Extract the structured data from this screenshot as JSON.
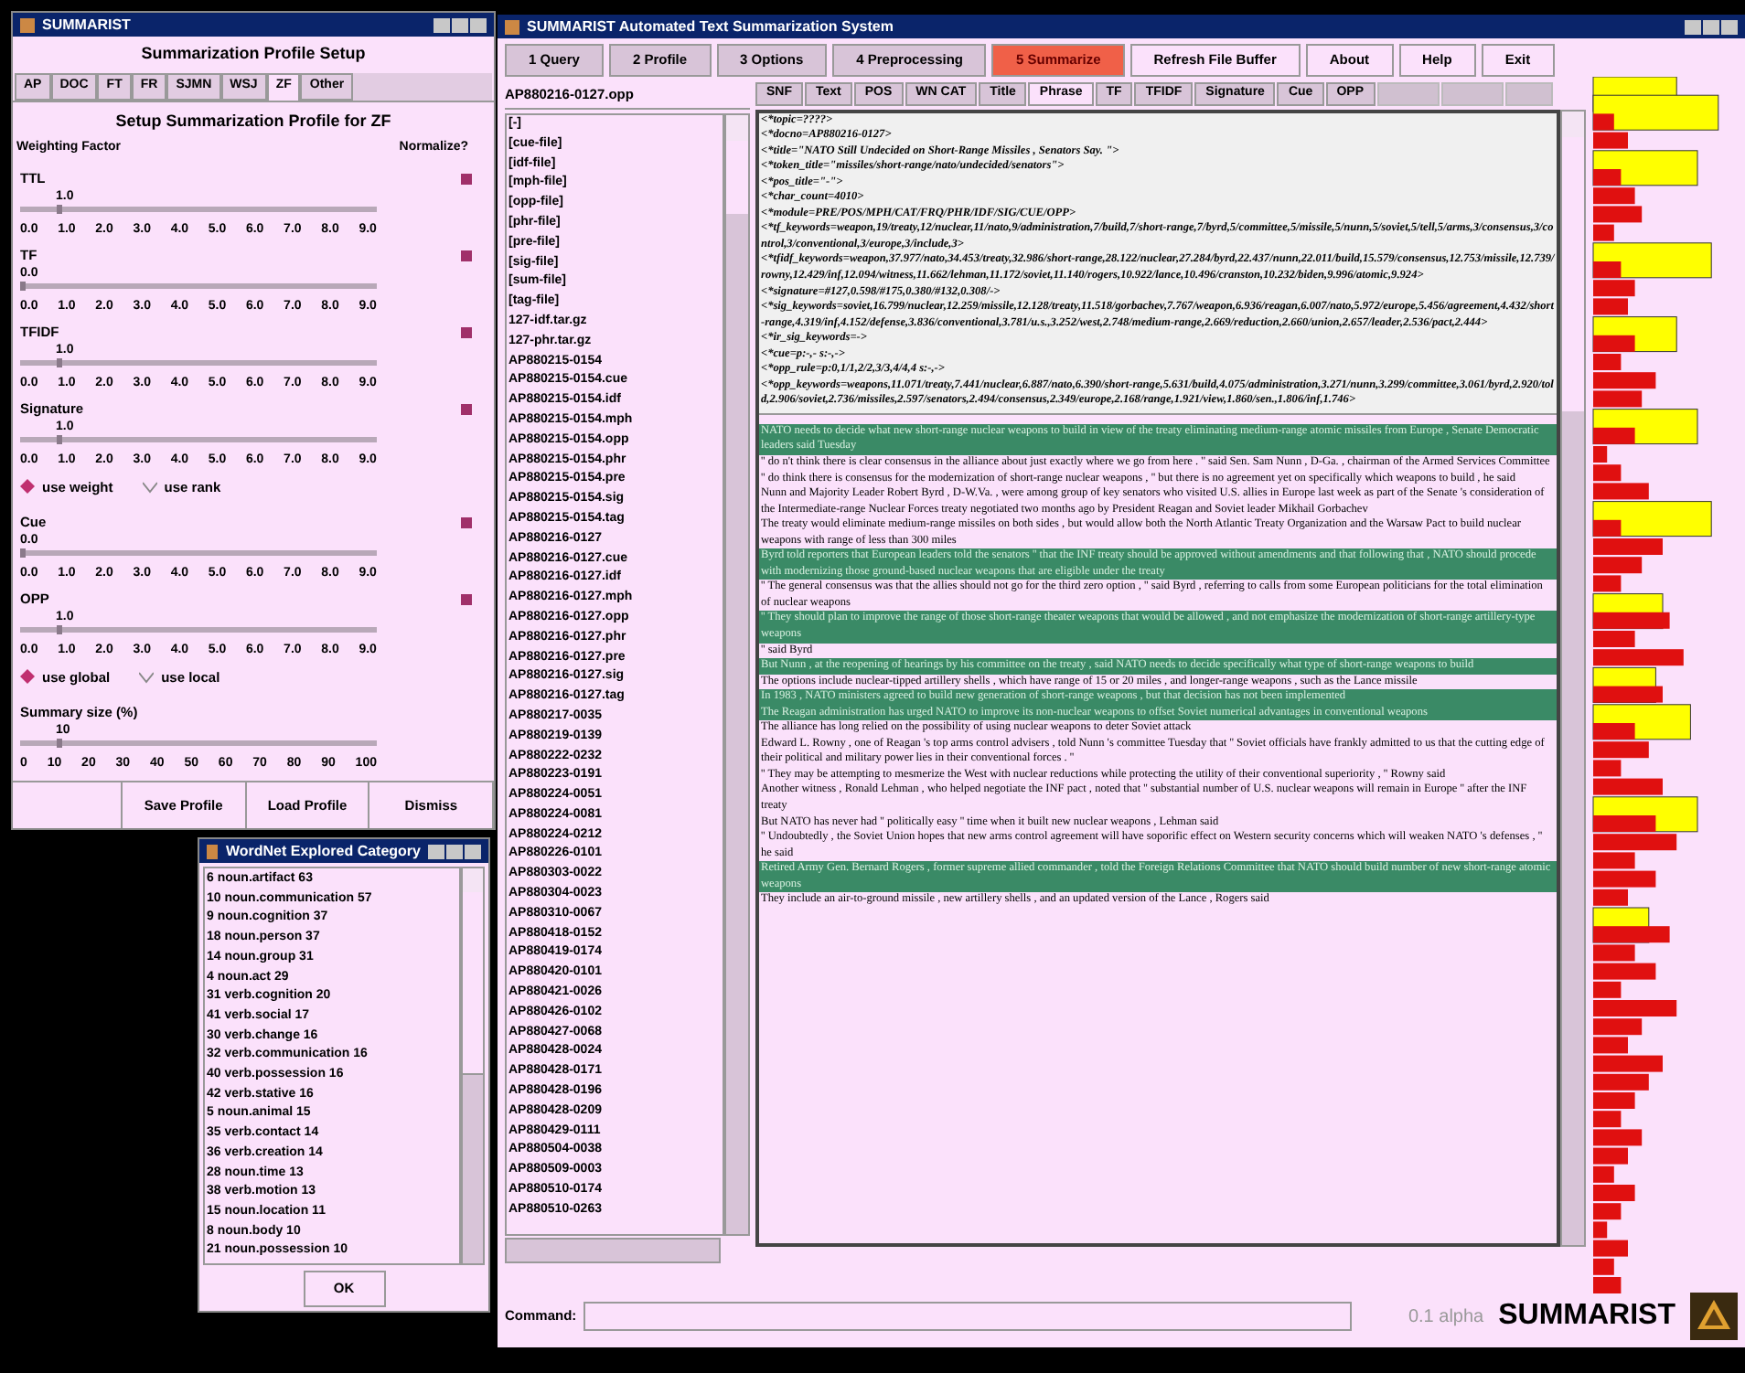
{
  "profile_window": {
    "title": "SUMMARIST",
    "heading": "Summarization Profile Setup",
    "tabs": [
      {
        "label": "AP",
        "selected": false
      },
      {
        "label": "DOC",
        "selected": false
      },
      {
        "label": "FT",
        "selected": false
      },
      {
        "label": "FR",
        "selected": false
      },
      {
        "label": "SJMN",
        "selected": false
      },
      {
        "label": "WSJ",
        "selected": false
      },
      {
        "label": "ZF",
        "selected": true
      },
      {
        "label": "Other",
        "selected": false
      }
    ],
    "subheading": "Setup Summarization Profile for ZF",
    "left_header": "Weighting Factor",
    "right_header": "Normalize?",
    "rows": [
      {
        "kind": "slider",
        "label": "TTL",
        "value": "1.0",
        "level": 0.1,
        "normalize": true,
        "ticks": [
          "0.0",
          "1.0",
          "2.0",
          "3.0",
          "4.0",
          "5.0",
          "6.0",
          "7.0",
          "8.0",
          "9.0"
        ]
      },
      {
        "kind": "slider",
        "label": "TF",
        "value": "0.0",
        "level": 0,
        "normalize": true,
        "ticks": [
          "0.0",
          "1.0",
          "2.0",
          "3.0",
          "4.0",
          "5.0",
          "6.0",
          "7.0",
          "8.0",
          "9.0"
        ]
      },
      {
        "kind": "slider",
        "label": "TFIDF",
        "value": "1.0",
        "level": 0.1,
        "normalize": true,
        "ticks": [
          "0.0",
          "1.0",
          "2.0",
          "3.0",
          "4.0",
          "5.0",
          "6.0",
          "7.0",
          "8.0",
          "9.0"
        ]
      },
      {
        "kind": "slider",
        "label": "Signature",
        "value": "1.0",
        "level": 0.1,
        "normalize": true,
        "ticks": [
          "0.0",
          "1.0",
          "2.0",
          "3.0",
          "4.0",
          "5.0",
          "6.0",
          "7.0",
          "8.0",
          "9.0"
        ]
      },
      {
        "kind": "radios",
        "options": [
          {
            "label": "use weight",
            "selected": true
          },
          {
            "label": "use rank",
            "selected": false
          }
        ]
      },
      {
        "kind": "slider",
        "label": "Cue",
        "value": "0.0",
        "level": 0,
        "normalize": true,
        "ticks": [
          "0.0",
          "1.0",
          "2.0",
          "3.0",
          "4.0",
          "5.0",
          "6.0",
          "7.0",
          "8.0",
          "9.0"
        ]
      },
      {
        "kind": "slider",
        "label": "OPP",
        "value": "1.0",
        "level": 0.1,
        "normalize": true,
        "ticks": [
          "0.0",
          "1.0",
          "2.0",
          "3.0",
          "4.0",
          "5.0",
          "6.0",
          "7.0",
          "8.0",
          "9.0"
        ]
      },
      {
        "kind": "radios",
        "options": [
          {
            "label": "use global",
            "selected": true
          },
          {
            "label": "use local",
            "selected": false
          }
        ]
      },
      {
        "kind": "slider",
        "label": "Summary size (%)",
        "value": "10",
        "level": 0.1,
        "ticks": [
          "0",
          "10",
          "20",
          "30",
          "40",
          "50",
          "60",
          "70",
          "80",
          "90",
          "100"
        ]
      }
    ],
    "buttons": [
      "Save Profile",
      "Load Profile",
      "Dismiss"
    ]
  },
  "wordnet_window": {
    "title": "WordNet Explored Category",
    "items": [
      "6 noun.artifact 63",
      "10 noun.communication 57",
      "9 noun.cognition 37",
      "18 noun.person 37",
      "14 noun.group 31",
      "4 noun.act 29",
      "31 verb.cognition 20",
      "41 verb.social 17",
      "30 verb.change 16",
      "32 verb.communication 16",
      "40 verb.possession 16",
      "42 verb.stative 16",
      "5 noun.animal 15",
      "35 verb.contact 14",
      "36 verb.creation 14",
      "28 noun.time 13",
      "38 verb.motion 13",
      "15 noun.location 11",
      "8 noun.body 10",
      "21 noun.possession 10"
    ],
    "button": "OK"
  },
  "main_window": {
    "title": "SUMMARIST Automated Text Summarization System",
    "menu": [
      {
        "label": "1 Query",
        "selected": false
      },
      {
        "label": "2 Profile",
        "selected": false
      },
      {
        "label": "3 Options",
        "selected": false
      },
      {
        "label": "4 Preprocessing",
        "selected": false
      },
      {
        "label": "5 Summarize",
        "selected": true
      }
    ],
    "actions": [
      "Refresh File Buffer",
      "About",
      "Help",
      "Exit"
    ],
    "file_field": "AP880216-0127.opp",
    "files": [
      "[-]",
      "[cue-file]",
      "[idf-file]",
      "[mph-file]",
      "[opp-file]",
      "[phr-file]",
      "[pre-file]",
      "[sig-file]",
      "[sum-file]",
      "[tag-file]",
      "127-idf.tar.gz",
      "127-phr.tar.gz",
      "AP880215-0154",
      "AP880215-0154.cue",
      "AP880215-0154.idf",
      "AP880215-0154.mph",
      "AP880215-0154.opp",
      "AP880215-0154.phr",
      "AP880215-0154.pre",
      "AP880215-0154.sig",
      "AP880215-0154.tag",
      "AP880216-0127",
      "AP880216-0127.cue",
      "AP880216-0127.idf",
      "AP880216-0127.mph",
      "AP880216-0127.opp",
      "AP880216-0127.phr",
      "AP880216-0127.pre",
      "AP880216-0127.sig",
      "AP880216-0127.tag",
      "AP880217-0035",
      "AP880219-0139",
      "AP880222-0232",
      "AP880223-0191",
      "AP880224-0051",
      "AP880224-0081",
      "AP880224-0212",
      "AP880226-0101",
      "AP880303-0022",
      "AP880304-0023",
      "AP880310-0067",
      "AP880418-0152",
      "AP880419-0174",
      "AP880420-0101",
      "AP880421-0026",
      "AP880426-0102",
      "AP880427-0068",
      "AP880428-0024",
      "AP880428-0171",
      "AP880428-0196",
      "AP880428-0209",
      "AP880429-0111",
      "AP880504-0038",
      "AP880509-0003",
      "AP880510-0174",
      "AP880510-0263"
    ],
    "tabs": [
      {
        "label": "SNF",
        "selected": false
      },
      {
        "label": "Text",
        "selected": false
      },
      {
        "label": "POS",
        "selected": false
      },
      {
        "label": "WN CAT",
        "selected": false
      },
      {
        "label": "Title",
        "selected": false
      },
      {
        "label": "Phrase",
        "selected": true
      },
      {
        "label": "TF",
        "selected": false
      },
      {
        "label": "TFIDF",
        "selected": false
      },
      {
        "label": "Signature",
        "selected": false
      },
      {
        "label": "Cue",
        "selected": false
      },
      {
        "label": "OPP",
        "selected": false
      }
    ],
    "header_lines": [
      "<*topic=????>",
      "<*docno=AP880216-0127>",
      "<*title=\"NATO Still Undecided on Short-Range Missiles , Senators Say. \">",
      "<*token_title=\"missiles/short-range/nato/undecided/senators\">",
      "<*pos_title=\"-\">",
      "<*char_count=4010>",
      "<*module=PRE/POS/MPH/CAT/FRQ/PHR/IDF/SIG/CUE/OPP>",
      "<*tf_keywords=weapon,19/treaty,12/nuclear,11/nato,9/administration,7/build,7/short-range,7/byrd,5/committee,5/missile,5/nunn,5/soviet,5/tell,5/arms,3/consensus,3/control,3/conventional,3/europe,3/include,3>",
      "<*tfidf_keywords=weapon,37.977/nato,34.453/treaty,32.986/short-range,28.122/nuclear,27.284/byrd,22.437/nunn,22.011/build,15.579/consensus,12.753/missile,12.739/rowny,12.429/inf,12.094/witness,11.662/lehman,11.172/soviet,11.140/rogers,10.922/lance,10.496/cranston,10.232/biden,9.996/atomic,9.924>",
      "<*signature=#127,0.598/#175,0.380/#132,0.308/->",
      "<*sig_keywords=soviet,16.799/nuclear,12.259/missile,12.128/treaty,11.518/gorbachev,7.767/weapon,6.936/reagan,6.007/nato,5.972/europe,5.456/agreement,4.432/short-range,4.319/inf,4.152/defense,3.836/conventional,3.781/u.s.,3.252/west,2.748/medium-range,2.669/reduction,2.660/union,2.657/leader,2.536/pact,2.444>",
      "<*ir_sig_keywords=->",
      "<*cue=p:-,- s:-,->",
      "<*opp_rule=p:0,1/1,2/2,3/3,4/4,4 s:-,->",
      "<*opp_keywords=weapons,11.071/treaty,7.441/nuclear,6.887/nato,6.390/short-range,5.631/build,4.075/administration,3.271/nunn,3.299/committee,3.061/byrd,2.920/told,2.906/soviet,2.736/missiles,2.597/senators,2.494/consensus,2.349/europe,2.168/range,1.921/view,1.860/sen.,1.806/inf,1.746>"
    ],
    "sentences": [
      {
        "text": "NATO needs to decide what new short-range nuclear weapons to build in view of the treaty eliminating medium-range atomic missiles from Europe , Senate Democratic leaders said Tuesday",
        "selected": true
      },
      {
        "text": "'' do n't think there is clear consensus in the alliance about just exactly where we go from here . '' said Sen. Sam Nunn , D-Ga. , chairman of the Armed Services Committee",
        "selected": false
      },
      {
        "text": "'' do think there is consensus for the modernization of short-range nuclear weapons , '' but there is no agreement yet on specifically which weapons to build , he said",
        "selected": false
      },
      {
        "text": "Nunn and Majority Leader Robert Byrd , D-W.Va. , were among group of key senators who visited U.S. allies in Europe last week as part of the Senate 's consideration of the Intermediate-range Nuclear Forces treaty negotiated two months ago by President Reagan and Soviet leader Mikhail Gorbachev",
        "selected": false
      },
      {
        "text": "The treaty would eliminate medium-range missiles on both sides , but would allow both the North Atlantic Treaty Organization and the Warsaw Pact to build nuclear weapons with range of less than 300 miles",
        "selected": false
      },
      {
        "text": "Byrd told reporters that European leaders told the senators '' that the INF treaty should be approved without amendments and that following that , NATO should procede with modernizing those ground-based nuclear weapons that are eligible under the treaty",
        "selected": true
      },
      {
        "text": "'' The general consensus was that the allies should not go for the third zero option , '' said Byrd , referring to calls from some European politicians for the total elimination of nuclear weapons",
        "selected": false
      },
      {
        "text": "'' They should plan to improve the range of those short-range theater weapons that would be allowed , and not emphasize the modernization of short-range artillery-type weapons",
        "selected": true
      },
      {
        "text": "'' said Byrd",
        "selected": false
      },
      {
        "text": "But Nunn , at the reopening of hearings by his committee on the treaty , said NATO needs to decide specifically what type of short-range weapons to build",
        "selected": true
      },
      {
        "text": "The options include nuclear-tipped artillery shells , which have range of 15 or 20 miles , and longer-range weapons , such as the Lance missile",
        "selected": false
      },
      {
        "text": "In 1983 , NATO ministers agreed to build new generation of short-range weapons , but that decision has not been implemented",
        "selected": true
      },
      {
        "text": "The Reagan administration has urged NATO to improve its non-nuclear weapons to offset Soviet numerical advantages in conventional weapons",
        "selected": true
      },
      {
        "text": "The alliance has long relied on the possibility of using nuclear weapons to deter Soviet attack",
        "selected": false
      },
      {
        "text": "Edward L. Rowny , one of Reagan 's top arms control advisers , told Nunn 's committee Tuesday that '' Soviet officials have frankly admitted to us that the cutting edge of their political and military power lies in their conventional forces . ''",
        "selected": false
      },
      {
        "text": "'' They may be attempting to mesmerize the West with nuclear reductions while protecting the utility of their conventional superiority , '' Rowny said",
        "selected": false
      },
      {
        "text": "Another witness , Ronald Lehman , who helped negotiate the INF pact , noted that '' substantial number of U.S. nuclear weapons will remain in Europe '' after the INF treaty",
        "selected": false
      },
      {
        "text": "But NATO has never had '' politically easy '' time when it built new nuclear weapons , Lehman said",
        "selected": false
      },
      {
        "text": "'' Undoubtedly , the Soviet Union hopes that new arms control agreement will have soporific effect on Western security concerns which will weaken NATO 's defenses , '' he said",
        "selected": false
      },
      {
        "text": "Retired Army Gen. Bernard Rogers , former supreme allied commander , told the Foreign Relations Committee that NATO should build number of new short-range atomic weapons",
        "selected": true
      },
      {
        "text": "They include an air-to-ground missile , new artillery shells , and an updated version of the Lance , Rogers said",
        "selected": false
      }
    ],
    "command_label": "Command:",
    "version": "0.1 alpha",
    "brand": "SUMMARIST"
  }
}
